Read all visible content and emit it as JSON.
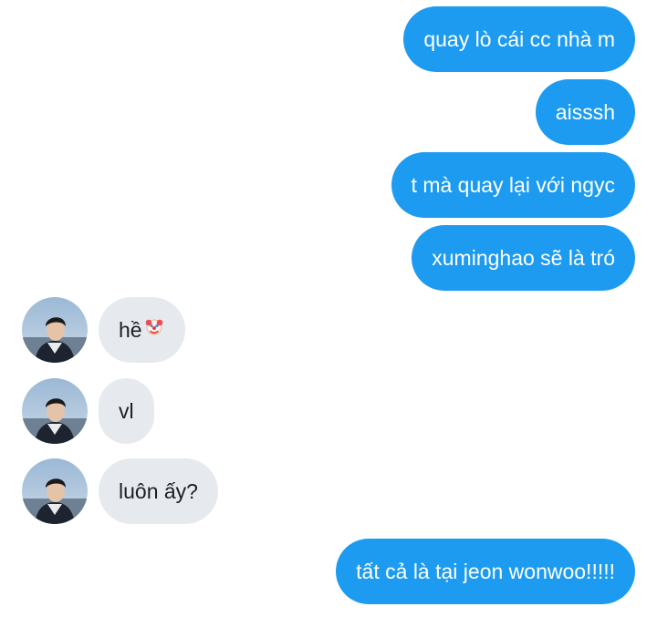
{
  "conversation": {
    "messages": [
      {
        "side": "out",
        "text": "quay lò cái cc nhà m"
      },
      {
        "side": "out",
        "text": "aisssh"
      },
      {
        "side": "out",
        "text": "t mà quay lại với ngyc"
      },
      {
        "side": "out",
        "text": "xuminghao sẽ là tró"
      },
      {
        "side": "in",
        "text": "hề",
        "emoji": "clown-face-icon",
        "avatar": "avatar-icon"
      },
      {
        "side": "in",
        "text": "vl",
        "avatar": "avatar-icon"
      },
      {
        "side": "in",
        "text": "luôn ấy?",
        "avatar": "avatar-icon"
      },
      {
        "side": "out",
        "text": "tất cả là tại jeon wonwoo!!!!!"
      }
    ]
  },
  "colors": {
    "outgoing_bubble": "#1d9bf0",
    "incoming_bubble": "#e6eaee",
    "outgoing_text": "#ffffff",
    "incoming_text": "#1b1f23"
  }
}
